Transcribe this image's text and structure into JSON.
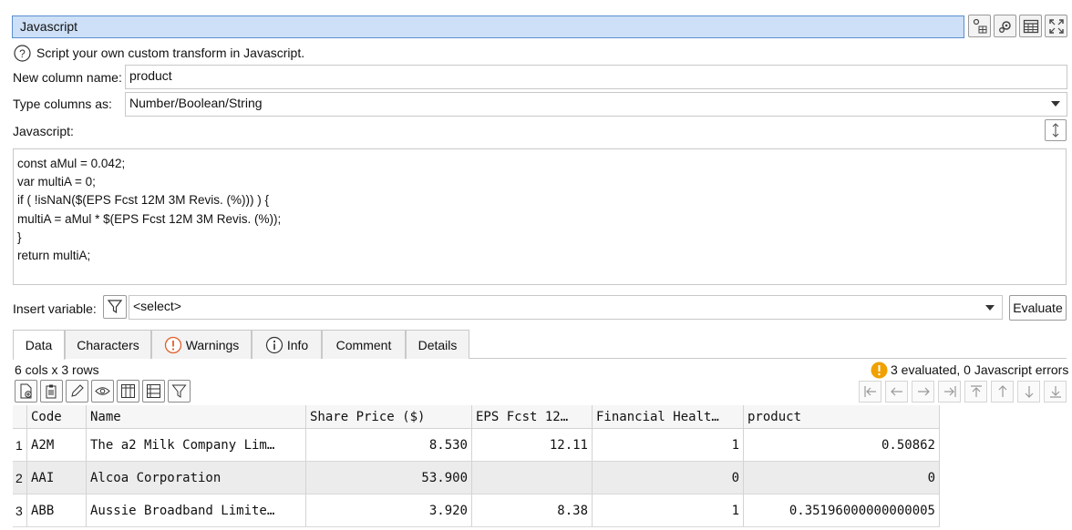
{
  "panel": {
    "title": "Javascript"
  },
  "help": {
    "icon": "help-circle-icon",
    "text": "Script your own custom transform in Javascript."
  },
  "new_column": {
    "label": "New column name:",
    "value": "product"
  },
  "type_columns": {
    "label": "Type columns as:",
    "value": "Number/Boolean/String"
  },
  "javascript": {
    "label": "Javascript:",
    "lines": [
      "const aMul = 0.042;",
      "var multiA = 0;",
      "if ( !isNaN($(EPS Fcst 12M 3M Revis. (%))) ) {",
      "multiA = aMul * $(EPS Fcst 12M 3M Revis. (%));",
      "}",
      "return multiA;"
    ]
  },
  "insert_variable": {
    "label": "Insert variable:",
    "select_value": "<select>"
  },
  "evaluate_button": "Evaluate",
  "tabs": [
    {
      "label": "Data"
    },
    {
      "label": "Characters"
    },
    {
      "label": "Warnings"
    },
    {
      "label": "Info"
    },
    {
      "label": "Comment"
    },
    {
      "label": "Details"
    }
  ],
  "summary": {
    "dims": "6 cols x 3 rows",
    "status": "3 evaluated, 0 Javascript errors",
    "status_color": "#f0a000"
  },
  "table": {
    "headers": [
      "Code",
      "Name",
      "Share Price ($)",
      "EPS Fcst 12…",
      "Financial Healt…",
      "product"
    ],
    "rows": [
      {
        "num": "1",
        "cells": [
          "A2M",
          "The a2 Milk Company Lim…",
          "8.530",
          "12.11",
          "1",
          "0.50862"
        ]
      },
      {
        "num": "2",
        "cells": [
          "AAI",
          "Alcoa Corporation",
          "53.900",
          "",
          "0",
          "0"
        ]
      },
      {
        "num": "3",
        "cells": [
          "ABB",
          "Aussie Broadband Limite…",
          "3.920",
          "8.38",
          "1",
          "0.35196000000000005"
        ]
      }
    ]
  },
  "colors": {
    "title_bg": "#cde0f7",
    "title_border": "#5a8fcf",
    "row_alt": "#ececec"
  }
}
